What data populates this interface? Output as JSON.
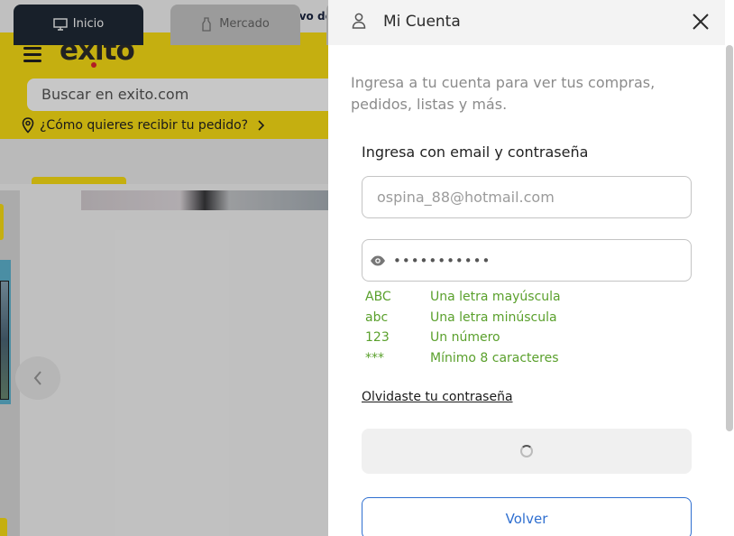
{
  "background_page": {
    "promo_text": "Lanzamiento exclusivo de c",
    "logo_text": "éxito",
    "search_placeholder": "Buscar en exito.com",
    "delivery_text": "¿Cómo quieres recibir tu pedido?",
    "tabs": [
      {
        "label": "Inicio",
        "icon": "monitor-icon",
        "active": true
      },
      {
        "label": "Mercado",
        "icon": "bottle-icon",
        "active": false
      }
    ],
    "colors": {
      "brand_yellow": "#fde115",
      "dark_tab": "#1f2a36"
    }
  },
  "drawer": {
    "title": "Mi Cuenta",
    "intro": "Ingresa a tu cuenta para ver tus compras, pedidos, listas y más.",
    "form_heading": "Ingresa con email y contraseña",
    "email_value": "ospina_88@hotmail.com",
    "password_masked": "•••••••••••",
    "password_rules": [
      {
        "code": "ABC",
        "text": "Una letra mayúscula"
      },
      {
        "code": "abc",
        "text": "Una letra minúscula"
      },
      {
        "code": "123",
        "text": "Un número"
      },
      {
        "code": "***",
        "text": "Mínimo 8 caracteres"
      }
    ],
    "forgot_link": "Olvidaste tu contraseña",
    "back_button": "Volver",
    "colors": {
      "rule_green": "#5aa02c",
      "back_blue": "#2f6fd0"
    }
  }
}
